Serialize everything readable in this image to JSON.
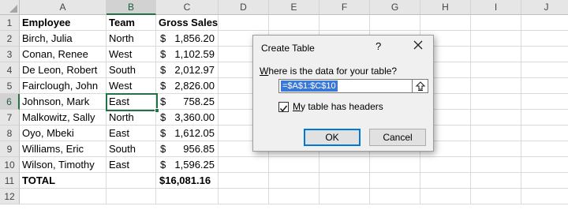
{
  "columns": [
    "A",
    "B",
    "C",
    "D",
    "E",
    "F",
    "G",
    "H",
    "I",
    "J"
  ],
  "rows": [
    "1",
    "2",
    "3",
    "4",
    "5",
    "6",
    "7",
    "8",
    "9",
    "10",
    "11",
    "12"
  ],
  "header": {
    "employee": "Employee",
    "team": "Team",
    "gross_sales": "Gross Sales"
  },
  "data": [
    {
      "employee": "Birch, Julia",
      "team": "North",
      "sym": "$",
      "amount": "1,856.20"
    },
    {
      "employee": "Conan, Renee",
      "team": "West",
      "sym": "$",
      "amount": "1,102.59"
    },
    {
      "employee": "De Leon, Robert",
      "team": "South",
      "sym": "$",
      "amount": "2,012.97"
    },
    {
      "employee": "Fairclough, John",
      "team": "West",
      "sym": "$",
      "amount": "2,826.00"
    },
    {
      "employee": "Johnson, Mark",
      "team": "East",
      "sym": "$",
      "amount": "758.25"
    },
    {
      "employee": "Malkowitz, Sally",
      "team": "North",
      "sym": "$",
      "amount": "3,360.00"
    },
    {
      "employee": "Oyo, Mbeki",
      "team": "East",
      "sym": "$",
      "amount": "1,612.05"
    },
    {
      "employee": "Williams, Eric",
      "team": "South",
      "sym": "$",
      "amount": "956.85"
    },
    {
      "employee": "Wilson, Timothy",
      "team": "East",
      "sym": "$",
      "amount": "1,596.25"
    }
  ],
  "total": {
    "label": "TOTAL",
    "amount": "$16,081.16"
  },
  "active_cell": {
    "column": "B",
    "row": "6"
  },
  "dialog": {
    "title": "Create Table",
    "help": "?",
    "prompt_first": "W",
    "prompt_rest": "here is the data for your table?",
    "range_value": "=$A$1:$C$10",
    "checkbox_checked": true,
    "checkbox_first": "M",
    "checkbox_rest": "y table has headers",
    "ok_label": "OK",
    "cancel_label": "Cancel"
  },
  "colors": {
    "accent": "#217346",
    "selection": "#3a78d8",
    "ok_border": "#0078d7"
  }
}
